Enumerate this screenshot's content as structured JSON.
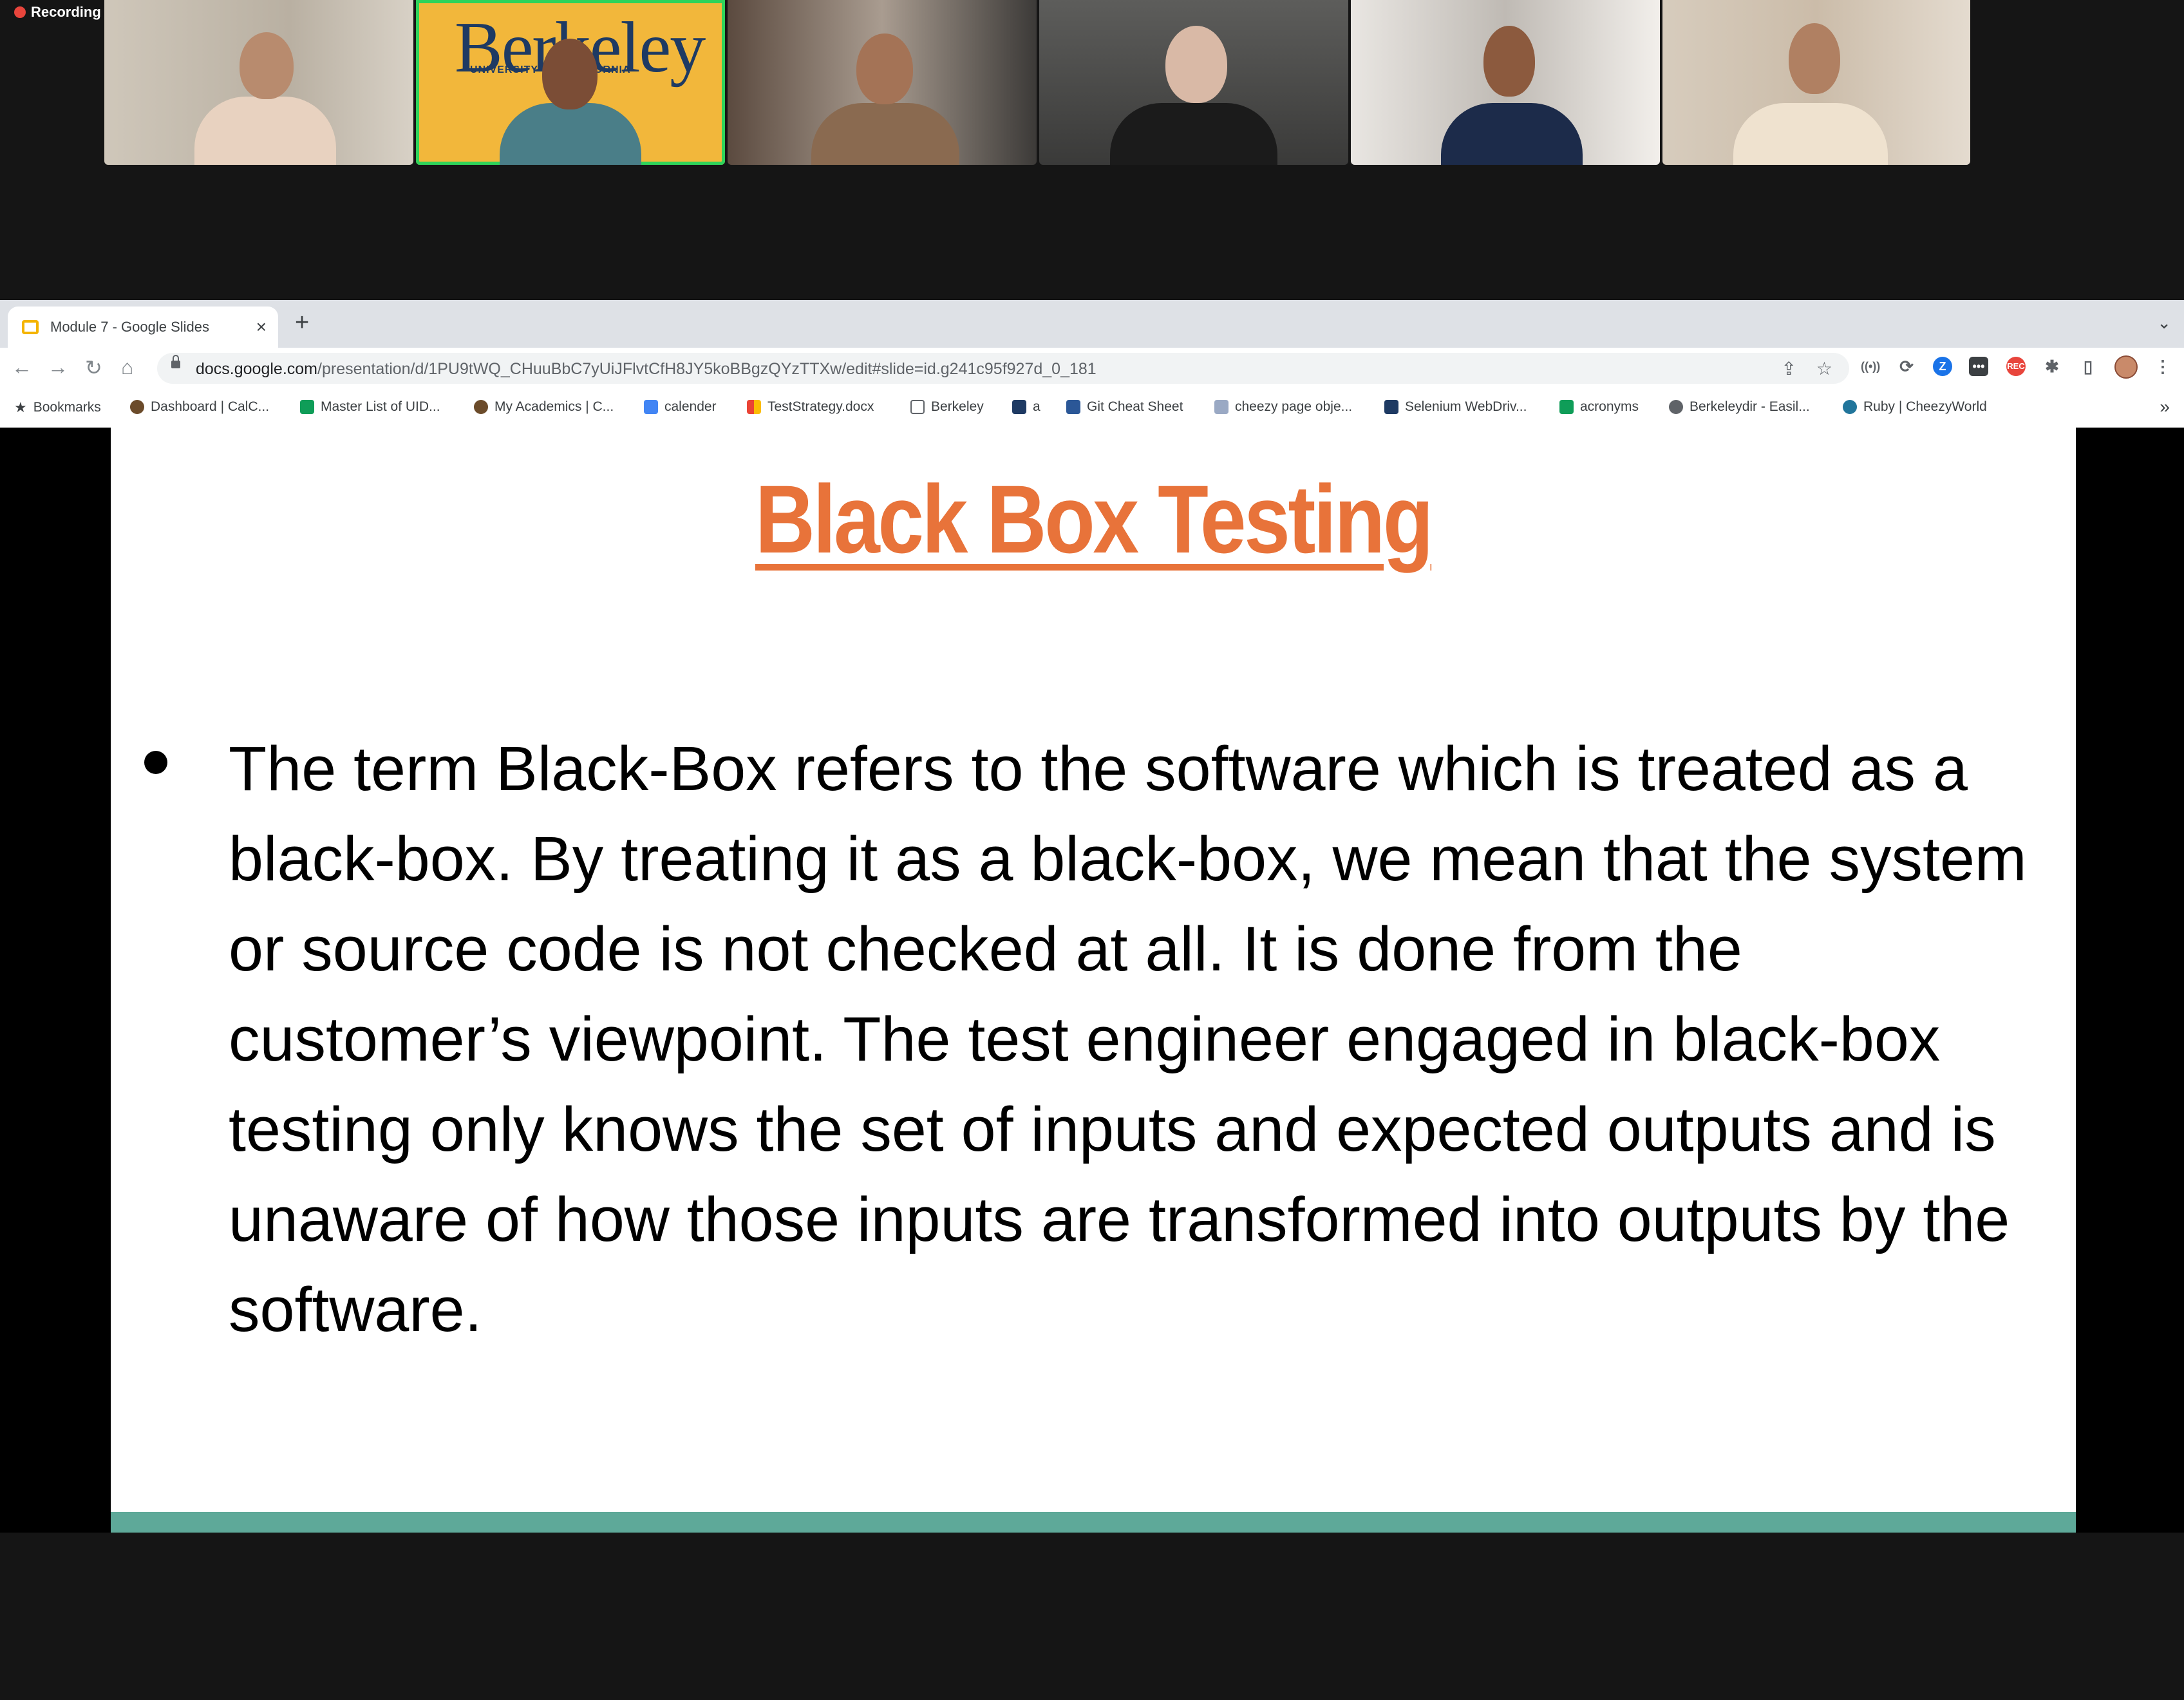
{
  "recording": {
    "label": "Recording"
  },
  "berkeley_tile": {
    "wordmark": "Berkeley",
    "subtitle": "UNIVERSITY OF CALIFORNIA"
  },
  "browser": {
    "tab_title": "Module 7 - Google Slides",
    "url_domain": "docs.google.com",
    "url_path": "/presentation/d/1PU9tWQ_CHuuBbC7yUiJFlvtCfH8JY5koBBgzQYzTTXw/edit#slide=id.g241c95f927d_0_181",
    "bookmarks": [
      "Bookmarks",
      "Dashboard | CalC...",
      "Master List of UID...",
      "My Academics | C...",
      "calender",
      "TestStrategy.docx",
      "Berkeley",
      "a",
      "Git Cheat Sheet",
      "cheezy page obje...",
      "Selenium WebDriv...",
      "acronyms",
      "Berkeleydir - Easil...",
      "Ruby | CheezyWorld"
    ]
  },
  "slide": {
    "title": "Black Box Testing",
    "bullet": "The term Black-Box refers to the software which is treated as a black-box. By treating it as a black-box, we mean that the system or source code is not checked at all. It is done from the customer’s viewpoint. The test  engineer engaged in black-box testing only knows the set of inputs and expected outputs and is unaware of how those inputs are transformed into outputs by the software.",
    "title_color": "#e8733a",
    "bar_color": "#5ea999"
  }
}
